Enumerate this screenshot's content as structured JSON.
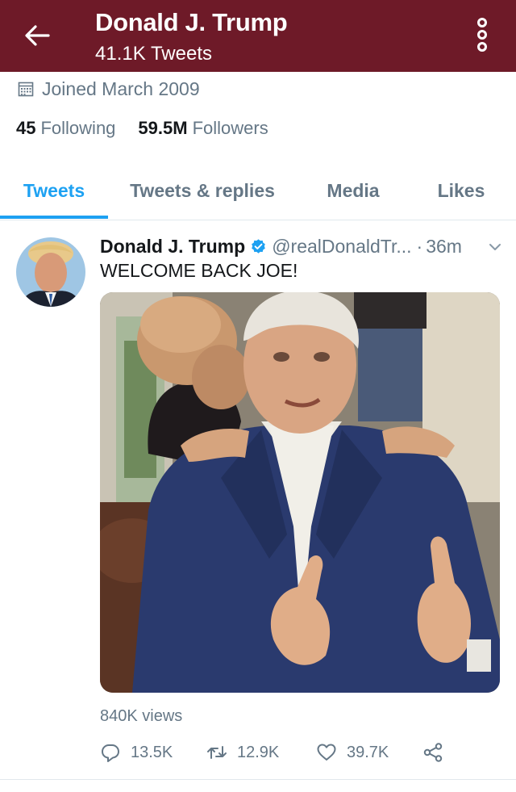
{
  "header": {
    "back_icon": "arrow-left-icon",
    "title": "Donald J. Trump",
    "subtitle": "41.1K Tweets",
    "more_icon": "more-vertical-icon",
    "background": "#6e1a28"
  },
  "profile": {
    "calendar_icon": "calendar-icon",
    "joined": "Joined March 2009",
    "following_count": "45",
    "following_label": "Following",
    "followers_count": "59.5M",
    "followers_label": "Followers"
  },
  "tabs": [
    {
      "label": "Tweets",
      "active": true
    },
    {
      "label": "Tweets & replies",
      "active": false
    },
    {
      "label": "Media",
      "active": false
    },
    {
      "label": "Likes",
      "active": false
    }
  ],
  "accent_color": "#1da1f2",
  "tweet": {
    "author_name": "Donald J. Trump",
    "verified_icon": "verified-badge-icon",
    "handle": "@realDonaldTr...",
    "separator": "·",
    "time": "36m",
    "caret_icon": "chevron-down-icon",
    "text": "WELCOME BACK JOE!",
    "media_description_icon": "video-thumbnail",
    "views": "840K views",
    "actions": {
      "reply_icon": "reply-icon",
      "reply_count": "13.5K",
      "retweet_icon": "retweet-icon",
      "retweet_count": "12.9K",
      "like_icon": "heart-icon",
      "like_count": "39.7K",
      "share_icon": "share-icon"
    }
  }
}
